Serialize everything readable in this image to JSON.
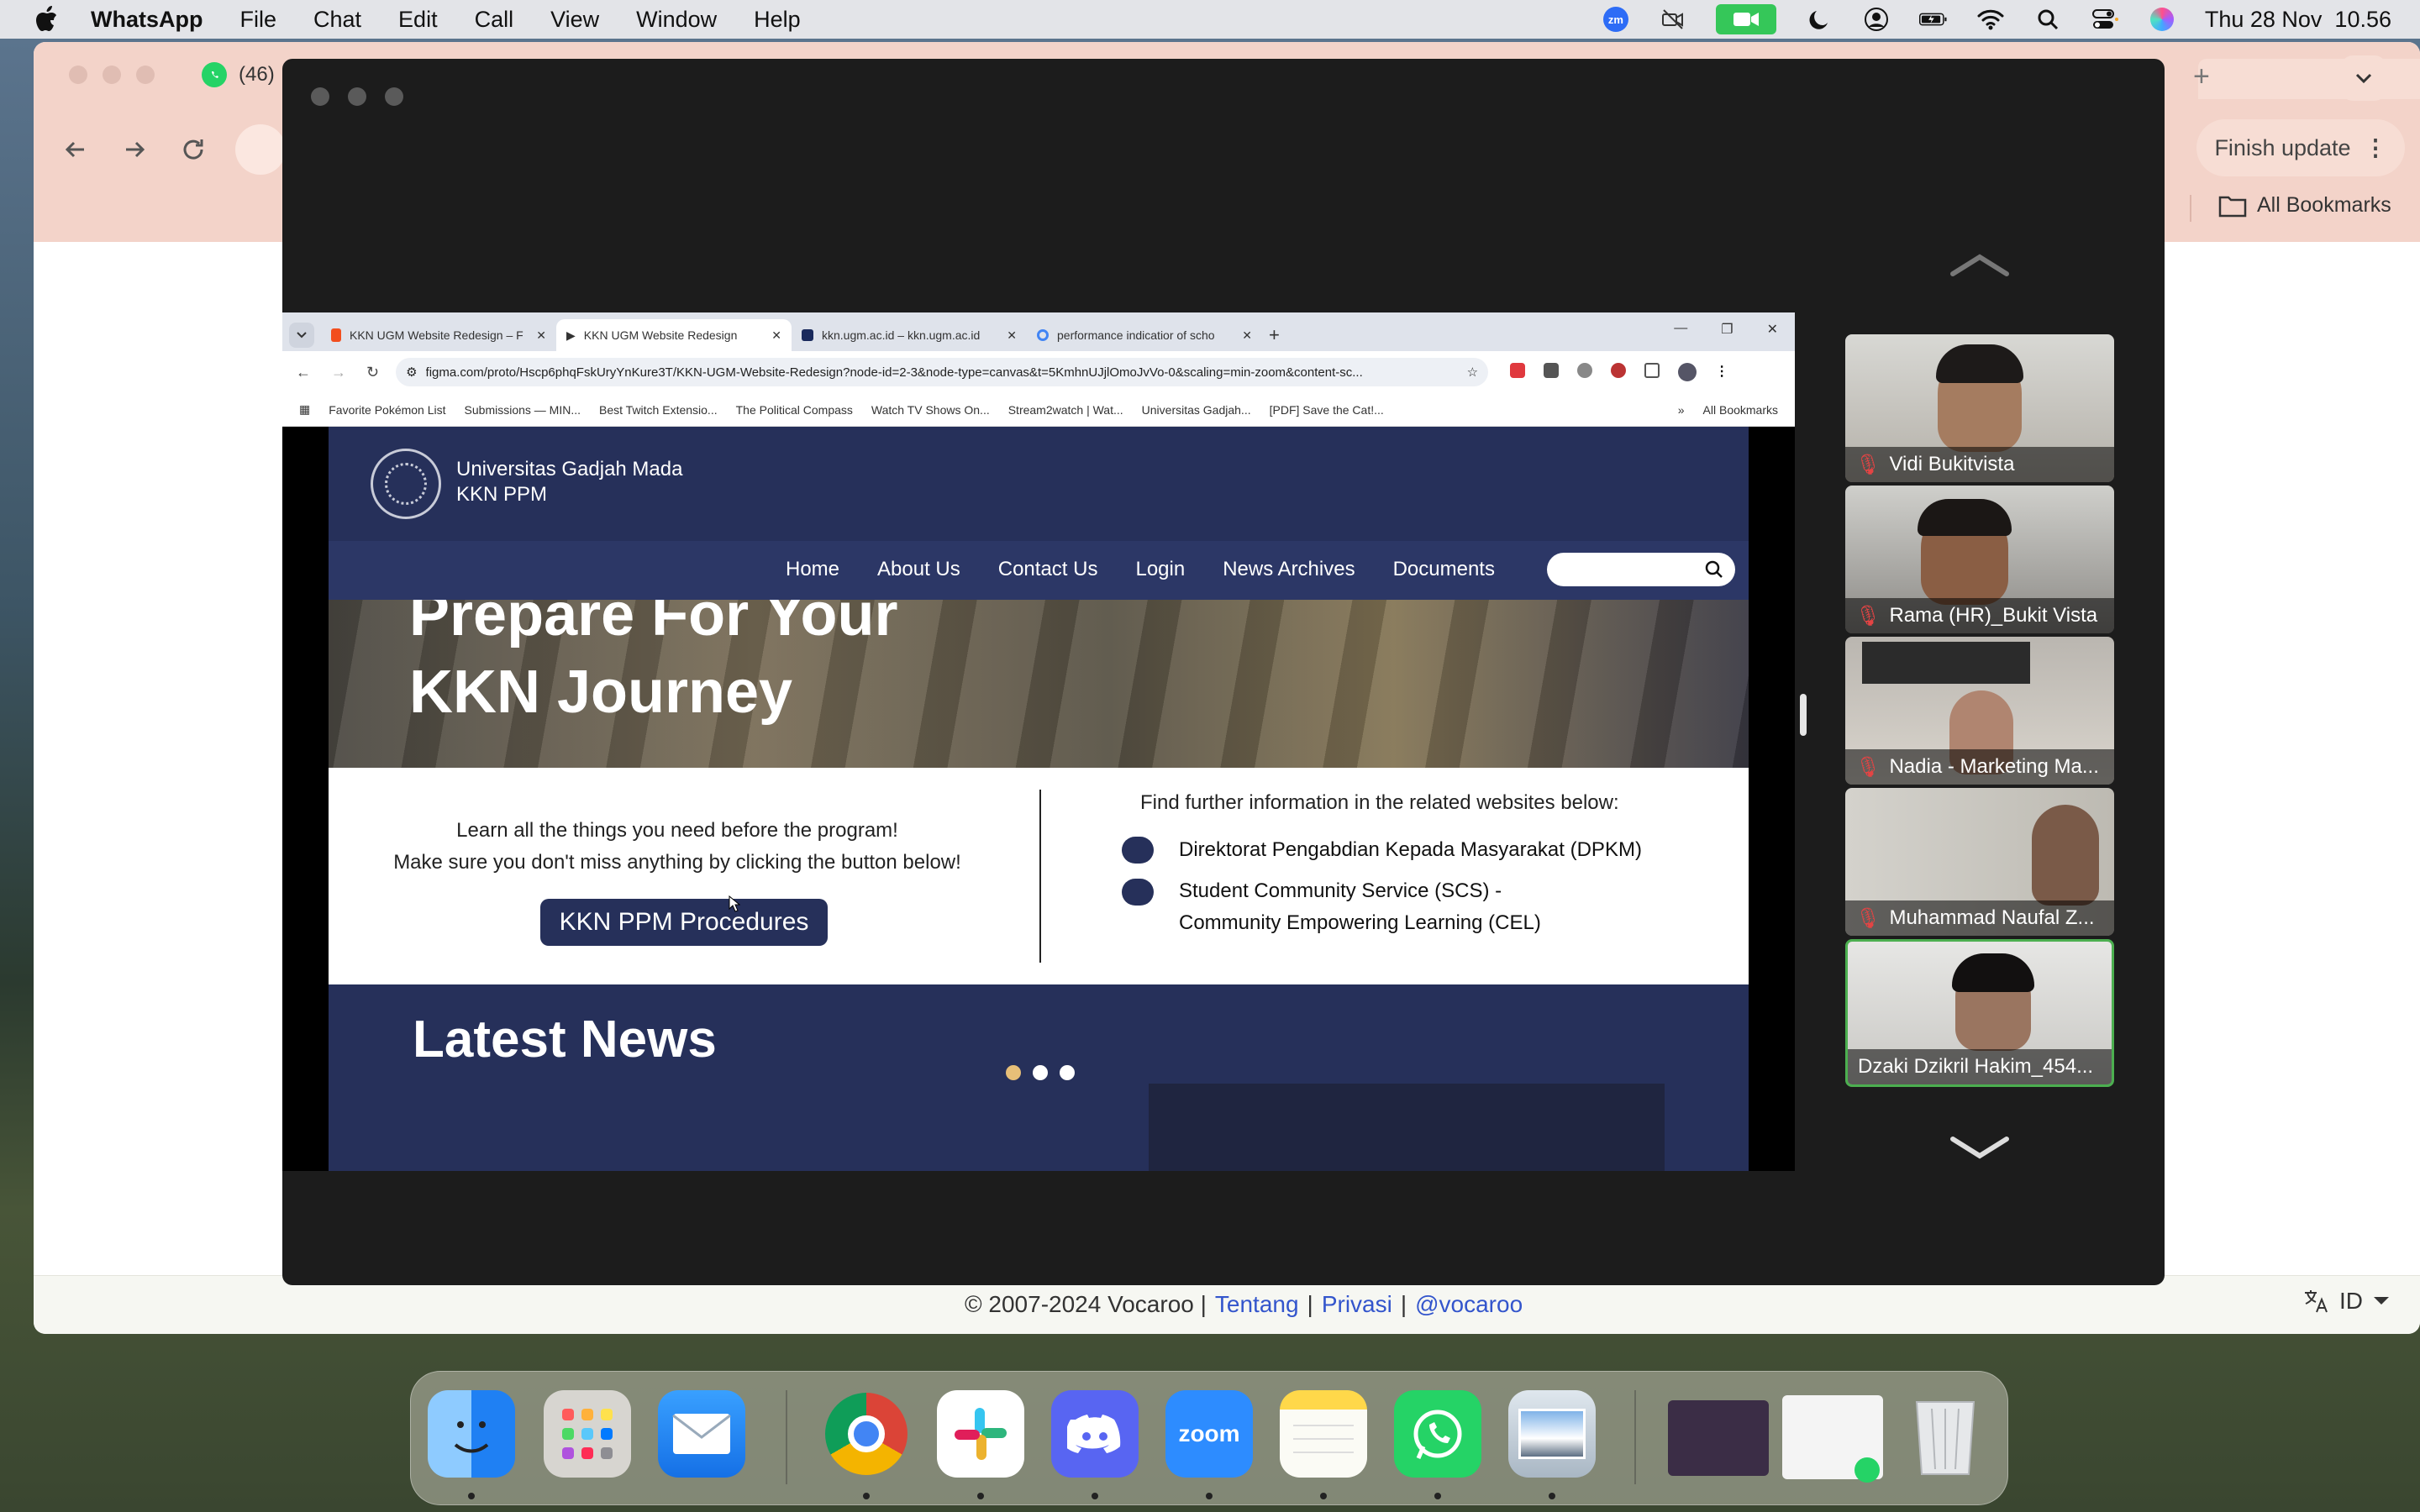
{
  "menubar": {
    "app": "WhatsApp",
    "items": [
      "File",
      "Chat",
      "Edit",
      "Call",
      "View",
      "Window",
      "Help"
    ],
    "datetime": "Thu 28 Nov  10.56",
    "zoom_badge": "zm"
  },
  "back_browser": {
    "whatsapp_tab": "(46)",
    "finish_update": "Finish update",
    "all_bookmarks": "All Bookmarks",
    "footer": {
      "copyright": "© 2007-2024 Vocaroo |",
      "tentang": "Tentang",
      "sep1": "|",
      "privasi": "Privasi",
      "sep2": "|",
      "handle": "@vocaroo",
      "lang": "ID"
    }
  },
  "inner_browser": {
    "tabs": [
      {
        "title": "KKN UGM Website Redesign – F",
        "color": "#f24e1e"
      },
      {
        "title": "KKN UGM Website Redesign",
        "color": "#222"
      },
      {
        "title": "kkn.ugm.ac.id – kkn.ugm.ac.id",
        "color": "#1a2a5c"
      },
      {
        "title": "performance indicatior of scho",
        "color": "#4285f4"
      }
    ],
    "url": "figma.com/proto/Hscp6phqFskUryYnKure3T/KKN-UGM-Website-Redesign?node-id=2-3&node-type=canvas&t=5KmhnUJjlOmoJvVo-0&scaling=min-zoom&content-sc...",
    "bookmarks": [
      "Favorite Pokémon List",
      "Submissions — MIN...",
      "Best Twitch Extensio...",
      "The Political Compass",
      "Watch TV Shows On...",
      "Stream2watch | Wat...",
      "Universitas Gadjah...",
      "[PDF] Save the Cat!..."
    ],
    "all_bookmarks": "All Bookmarks"
  },
  "site": {
    "org": "Universitas Gadjah Mada",
    "sub": "KKN PPM",
    "nav": [
      "Home",
      "About Us",
      "Contact Us",
      "Login",
      "News Archives",
      "Documents"
    ],
    "hero": [
      "Prepare For Your",
      "KKN Journey"
    ],
    "learn1": "Learn all the things you need before the program!",
    "learn2": "Make sure you don't miss anything by clicking the button below!",
    "button": "KKN PPM Procedures",
    "further": "Find further information in the related websites below:",
    "link1": "Direktorat Pengabdian Kepada Masyarakat (DPKM)",
    "link2a": "Student Community Service (SCS) -",
    "link2b": "Community Empowering Learning (CEL)",
    "latest": "Latest News"
  },
  "participants": [
    "Vidi Bukitvista",
    "Rama (HR)_Bukit Vista",
    "Nadia - Marketing Ma...",
    "Muhammad Naufal Z...",
    "Dzaki Dzikril Hakim_454..."
  ],
  "dock": [
    "Finder",
    "Launchpad",
    "Mail",
    "Chrome",
    "Slack",
    "Discord",
    "Zoom",
    "Notes",
    "WhatsApp",
    "Preview",
    "Window Thumbnail",
    "Window Thumbnail",
    "Trash"
  ],
  "colors": {
    "navy": "#26305a",
    "accent": "#e7bf78",
    "active_speaker": "#4caf50"
  }
}
